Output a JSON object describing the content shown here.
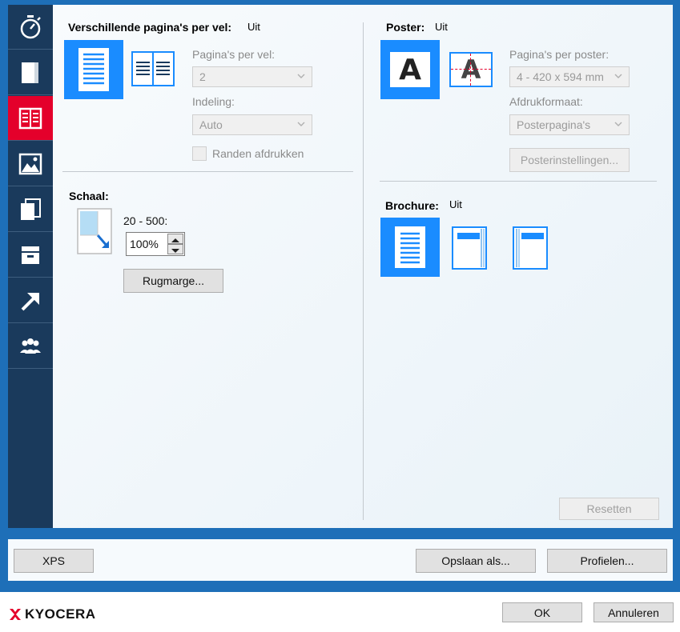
{
  "sidebar": {
    "items": [
      {
        "icon": "stopwatch-icon"
      },
      {
        "icon": "page-icon"
      },
      {
        "icon": "layout-icon",
        "active": true
      },
      {
        "icon": "image-icon"
      },
      {
        "icon": "copies-icon"
      },
      {
        "icon": "output-tray-icon"
      },
      {
        "icon": "arrow-icon"
      },
      {
        "icon": "users-icon"
      }
    ],
    "active_color": "#e4002b"
  },
  "multi_page": {
    "title": "Verschillende pagina's per vel:",
    "state": "Uit",
    "pages_label": "Pagina's per vel:",
    "pages_value": "2",
    "layout_label": "Indeling:",
    "layout_value": "Auto",
    "borders_label": "Randen afdrukken"
  },
  "scale": {
    "title": "Schaal:",
    "range_label": "20 - 500:",
    "value": "100%",
    "margin_button": "Rugmarge..."
  },
  "poster": {
    "title": "Poster:",
    "state": "Uit",
    "pages_label": "Pagina's per poster:",
    "pages_value": "4 - 420 x 594 mm",
    "format_label": "Afdrukformaat:",
    "format_value": "Posterpagina's",
    "settings_button": "Posterinstellingen...",
    "tile_letter": "A"
  },
  "brochure": {
    "title": "Brochure:",
    "state": "Uit"
  },
  "reset_button": "Resetten",
  "bottom_bar": {
    "xps": "XPS",
    "save_as": "Opslaan als...",
    "profiles": "Profielen..."
  },
  "footer": {
    "brand": "KYOCERA",
    "ok": "OK",
    "cancel": "Annuleren"
  },
  "colors": {
    "accent_blue": "#1a8cff",
    "frame_blue": "#1e6fb8",
    "sidebar_dark": "#1a3a5c",
    "brand_red": "#e4002b"
  }
}
